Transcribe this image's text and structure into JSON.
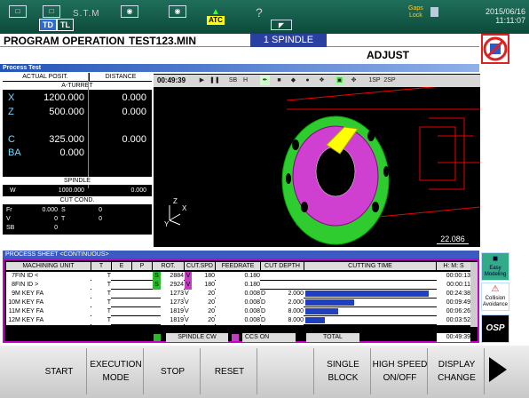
{
  "status_bar": {
    "stm": "S.T.M",
    "td": "TD",
    "tl": "TL",
    "atc": "ATC",
    "help": "?",
    "gaps_lock": "Gaps\nLock",
    "date": "2015/06/16",
    "time": "11:11:07"
  },
  "header": {
    "mode": "PROGRAM OPERATION",
    "program": "TEST123.MIN",
    "spindle": "1 SPINDLE",
    "adjust": "ADJUST"
  },
  "panel_title": "Process Test",
  "position": {
    "h_actual": "ACTUAL POSIT.",
    "h_distance": "DISTANCE",
    "h_turret": "A-TURRET",
    "axes": [
      {
        "n": "X",
        "a": "1200.000",
        "d": "0.000"
      },
      {
        "n": "Z",
        "a": "500.000",
        "d": "0.000"
      },
      {
        "n": "C",
        "a": "325.000",
        "d": "0.000"
      },
      {
        "n": "BA",
        "a": "0.000",
        "d": ""
      }
    ],
    "h_spindle": "SPINDLE",
    "spindle_w": "W",
    "spindle_a": "1000.000",
    "spindle_d": "0.000",
    "h_cut": "CUT COND.",
    "fr": "Fr",
    "fr_v": "0.000",
    "s": "S",
    "s_v": "0",
    "v": "V",
    "v_v": "0",
    "t": "T",
    "t_v": "0",
    "sb": "SB",
    "sb_v": "0"
  },
  "view": {
    "elapsed": "00:49:39",
    "tools": [
      "▶",
      "❚❚",
      "SB",
      "H",
      "✒",
      "■",
      "◆",
      "●",
      "❖",
      "▣",
      "✥"
    ],
    "p1": "1SP",
    "p2": "2SP",
    "scale": "22.086",
    "axis_x": "X",
    "axis_y": "Y",
    "axis_z": "Z"
  },
  "process_sheet": {
    "label": "PROCESS SHEET",
    "mode": "<CONTINUOUS>",
    "cols": [
      "MACHINING UNIT",
      "T",
      "E",
      "P",
      "ROT.",
      "CUT.SPD",
      "FEEDRATE",
      "CUT DEPTH",
      "CUTTING TIME",
      "H: M: S"
    ],
    "rows": [
      {
        "no": "7",
        "unit": "FIN ID <",
        "t": "T",
        "s": "S",
        "rot": "2884",
        "v": "V",
        "spd": "180",
        "feed": "0.180",
        "dep": "",
        "dval": "",
        "bar": 0,
        "time": "00:00:13"
      },
      {
        "no": "8",
        "unit": "FIN ID >",
        "t": "T",
        "s": "S",
        "rot": "2924",
        "v": "V",
        "spd": "180",
        "feed": "0.180",
        "dep": "",
        "dval": "",
        "bar": 0,
        "time": "00:00:11"
      },
      {
        "no": "9",
        "unit": "M KEY FA",
        "t": "T",
        "s": "",
        "rot": "1273",
        "v": "V",
        "spd": "20",
        "feed": "0.008",
        "dep": "D",
        "dval": "2.000",
        "bar": 0.95,
        "time": "00:24:38"
      },
      {
        "no": "10",
        "unit": "M KEY FA",
        "t": "T",
        "s": "",
        "rot": "1273",
        "v": "V",
        "spd": "20",
        "feed": "0.008",
        "dep": "D",
        "dval": "2.000",
        "bar": 0.38,
        "time": "00:09:49"
      },
      {
        "no": "11",
        "unit": "M KEY FA",
        "t": "T",
        "s": "",
        "rot": "1819",
        "v": "V",
        "spd": "20",
        "feed": "0.008",
        "dep": "D",
        "dval": "8.000",
        "bar": 0.25,
        "time": "00:06:26"
      },
      {
        "no": "12",
        "unit": "M KEY FA",
        "t": "T",
        "s": "",
        "rot": "1819",
        "v": "V",
        "spd": "20",
        "feed": "0.008",
        "dep": "D",
        "dval": "8.000",
        "bar": 0.15,
        "time": "00:03:52"
      }
    ],
    "legend_spindle": "SPINDLE CW",
    "legend_css": "CCS ON",
    "total_label": "TOTAL",
    "total": "00:49:39"
  },
  "side": {
    "easy": "Easy Modeling",
    "coll": "Collision Avoidance",
    "osp": "OSP"
  },
  "fkeys": [
    "START",
    "EXECUTION\nMODE",
    "STOP",
    "RESET",
    "",
    "SINGLE\nBLOCK",
    "HIGH SPEED\nON/OFF",
    "DISPLAY\nCHANGE"
  ],
  "colors": {
    "spindle_cw": "#2db82d",
    "ccs_on": "#c040c0",
    "bar": "#2040c0"
  }
}
